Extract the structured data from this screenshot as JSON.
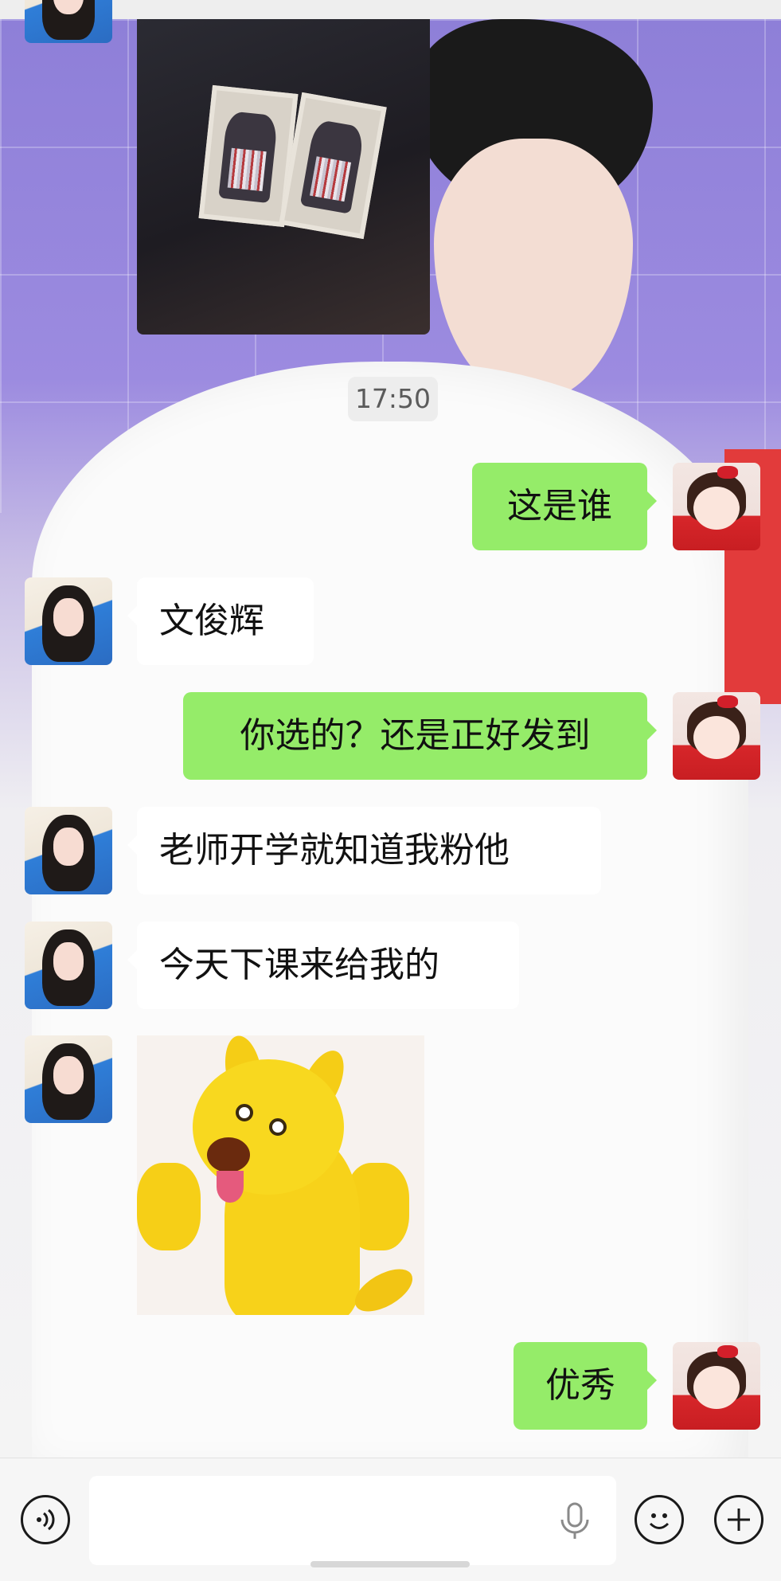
{
  "chat": {
    "timestamp": "17:50",
    "messages": [
      {
        "side": "in",
        "type": "image",
        "content": "photo-cards"
      },
      {
        "side": "out",
        "type": "text",
        "text": "这是谁"
      },
      {
        "side": "in",
        "type": "text",
        "text": "文俊辉"
      },
      {
        "side": "out",
        "type": "text",
        "text": "你选的？还是正好发到"
      },
      {
        "side": "in",
        "type": "text",
        "text": "老师开学就知道我粉他"
      },
      {
        "side": "in",
        "type": "text",
        "text": "今天下课来给我的"
      },
      {
        "side": "in",
        "type": "sticker",
        "content": "yellow-kangaroo-peace-sticker"
      },
      {
        "side": "out",
        "type": "text",
        "text": "优秀"
      }
    ]
  },
  "input_bar": {
    "voice_icon": "voice-toggle-icon",
    "mic_icon": "microphone-icon",
    "emoji_icon": "emoji-icon",
    "plus_icon": "plus-icon",
    "text_value": ""
  },
  "colors": {
    "outgoing_bubble": "#95ec69",
    "incoming_bubble": "#ffffff",
    "input_bar_bg": "#f6f6f6"
  }
}
